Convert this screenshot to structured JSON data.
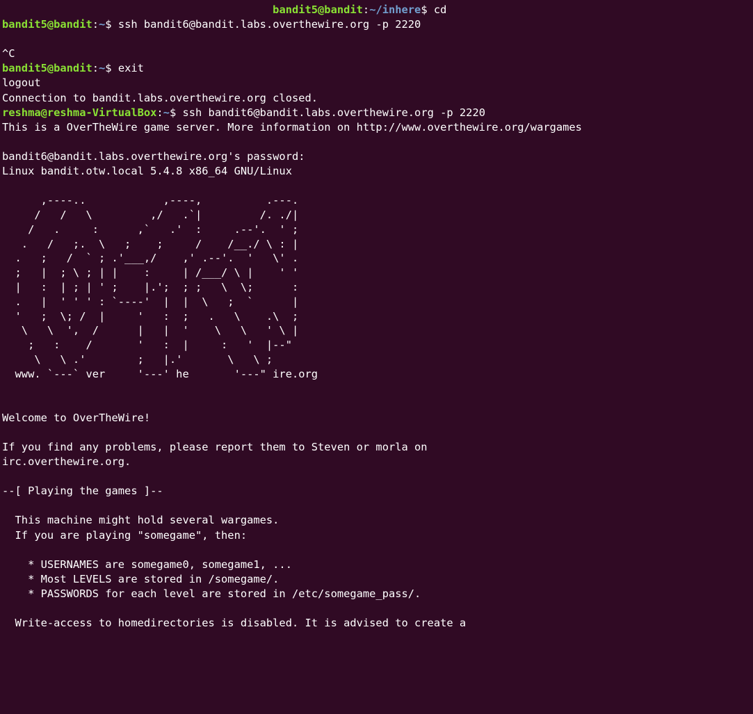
{
  "window": {
    "title": "",
    "background": "#300a24",
    "foreground": "#ffffff",
    "user_host_color": "#8ae234",
    "path_color": "#729fcf"
  },
  "terminal": {
    "lines": [
      {
        "id": "prompt-wrapped",
        "segments": [
          {
            "t": "                                          ",
            "c": "w"
          },
          {
            "t": "bandit5@bandit",
            "c": "u"
          },
          {
            "t": ":",
            "c": "w"
          },
          {
            "t": "~/inhere",
            "c": "p"
          },
          {
            "t": "$ cd",
            "c": "w"
          }
        ]
      },
      {
        "id": "prompt-ssh-1",
        "segments": [
          {
            "t": "bandit5@bandit",
            "c": "u"
          },
          {
            "t": ":",
            "c": "w"
          },
          {
            "t": "~",
            "c": "p"
          },
          {
            "t": "$ ssh bandit6@bandit.labs.overthewire.org -p 2220",
            "c": "w"
          }
        ]
      },
      {
        "id": "blank-1",
        "segments": [
          {
            "t": "",
            "c": "w"
          }
        ]
      },
      {
        "id": "ctrl-c",
        "segments": [
          {
            "t": "^C",
            "c": "w"
          }
        ]
      },
      {
        "id": "prompt-exit",
        "segments": [
          {
            "t": "bandit5@bandit",
            "c": "u"
          },
          {
            "t": ":",
            "c": "w"
          },
          {
            "t": "~",
            "c": "p"
          },
          {
            "t": "$ exit",
            "c": "w"
          }
        ]
      },
      {
        "id": "logout",
        "segments": [
          {
            "t": "logout",
            "c": "w"
          }
        ]
      },
      {
        "id": "connection-closed",
        "segments": [
          {
            "t": "Connection to bandit.labs.overthewire.org closed.",
            "c": "w"
          }
        ]
      },
      {
        "id": "prompt-ssh-2",
        "segments": [
          {
            "t": "reshma@reshma-VirtualBox",
            "c": "u"
          },
          {
            "t": ":",
            "c": "w"
          },
          {
            "t": "~",
            "c": "p"
          },
          {
            "t": "$ ssh bandit6@bandit.labs.overthewire.org -p 2220",
            "c": "w"
          }
        ]
      },
      {
        "id": "server-banner",
        "segments": [
          {
            "t": "This is a OverTheWire game server. More information on http://www.overthewire.org/wargames",
            "c": "w"
          }
        ]
      },
      {
        "id": "blank-2",
        "segments": [
          {
            "t": "",
            "c": "w"
          }
        ]
      },
      {
        "id": "password-prompt",
        "segments": [
          {
            "t": "bandit6@bandit.labs.overthewire.org's password:",
            "c": "w"
          }
        ]
      },
      {
        "id": "uname",
        "segments": [
          {
            "t": "Linux bandit.otw.local 5.4.8 x86_64 GNU/Linux",
            "c": "w"
          }
        ]
      },
      {
        "id": "blank-3",
        "segments": [
          {
            "t": "",
            "c": "w"
          }
        ]
      }
    ],
    "ascii_art": "      ,----..            ,----,          .---.\n     /   /   \\         ,/   .`|         /. ./|\n    /   .     :      ,`   .'  :     .--'.  ' ;\n   .   /   ;.  \\   ;    ;     /    /__./ \\ : |\n  .   ;   /  ` ; .'___,/    ,' .--'.  '   \\' .\n  ;   |  ; \\ ; | |    :     | /___/ \\ |    ' '\n  |   :  | ; | ' ;    |.';  ; ;   \\  \\;      :\n  .   |  ' ' ' : `----'  |  |  \\   ;  `      |\n  '   ;  \\; /  |     '   :  ;   .   \\    .\\  ;\n   \\   \\  ',  /      |   |  '    \\   \\   ' \\ |\n    ;   :    /       '   :  |     :   '  |--\"\n     \\   \\ .'        ;   |.'       \\   \\ ;\n  www. `---` ver     '---' he       '---\" ire.org",
    "after_lines": [
      {
        "id": "blank-4",
        "segments": [
          {
            "t": "",
            "c": "w"
          }
        ]
      },
      {
        "id": "blank-5",
        "segments": [
          {
            "t": "",
            "c": "w"
          }
        ]
      },
      {
        "id": "welcome",
        "segments": [
          {
            "t": "Welcome to OverTheWire!",
            "c": "w"
          }
        ]
      },
      {
        "id": "blank-6",
        "segments": [
          {
            "t": "",
            "c": "w"
          }
        ]
      },
      {
        "id": "problems-1",
        "segments": [
          {
            "t": "If you find any problems, please report them to Steven or morla on",
            "c": "w"
          }
        ]
      },
      {
        "id": "problems-2",
        "segments": [
          {
            "t": "irc.overthewire.org.",
            "c": "w"
          }
        ]
      },
      {
        "id": "blank-7",
        "segments": [
          {
            "t": "",
            "c": "w"
          }
        ]
      },
      {
        "id": "section-playing",
        "segments": [
          {
            "t": "--[ Playing the games ]--",
            "c": "w"
          }
        ]
      },
      {
        "id": "blank-8",
        "segments": [
          {
            "t": "",
            "c": "w"
          }
        ]
      },
      {
        "id": "machine-hold",
        "segments": [
          {
            "t": "  This machine might hold several wargames.",
            "c": "w"
          }
        ]
      },
      {
        "id": "if-playing",
        "segments": [
          {
            "t": "  If you are playing \"somegame\", then:",
            "c": "w"
          }
        ]
      },
      {
        "id": "blank-9",
        "segments": [
          {
            "t": "",
            "c": "w"
          }
        ]
      },
      {
        "id": "usernames",
        "segments": [
          {
            "t": "    * USERNAMES are somegame0, somegame1, ...",
            "c": "w"
          }
        ]
      },
      {
        "id": "levels",
        "segments": [
          {
            "t": "    * Most LEVELS are stored in /somegame/.",
            "c": "w"
          }
        ]
      },
      {
        "id": "passwords",
        "segments": [
          {
            "t": "    * PASSWORDS for each level are stored in /etc/somegame_pass/.",
            "c": "w"
          }
        ]
      },
      {
        "id": "blank-10",
        "segments": [
          {
            "t": "",
            "c": "w"
          }
        ]
      },
      {
        "id": "write-access",
        "segments": [
          {
            "t": "  Write-access to homedirectories is disabled. It is advised to create a",
            "c": "w"
          }
        ]
      }
    ]
  }
}
